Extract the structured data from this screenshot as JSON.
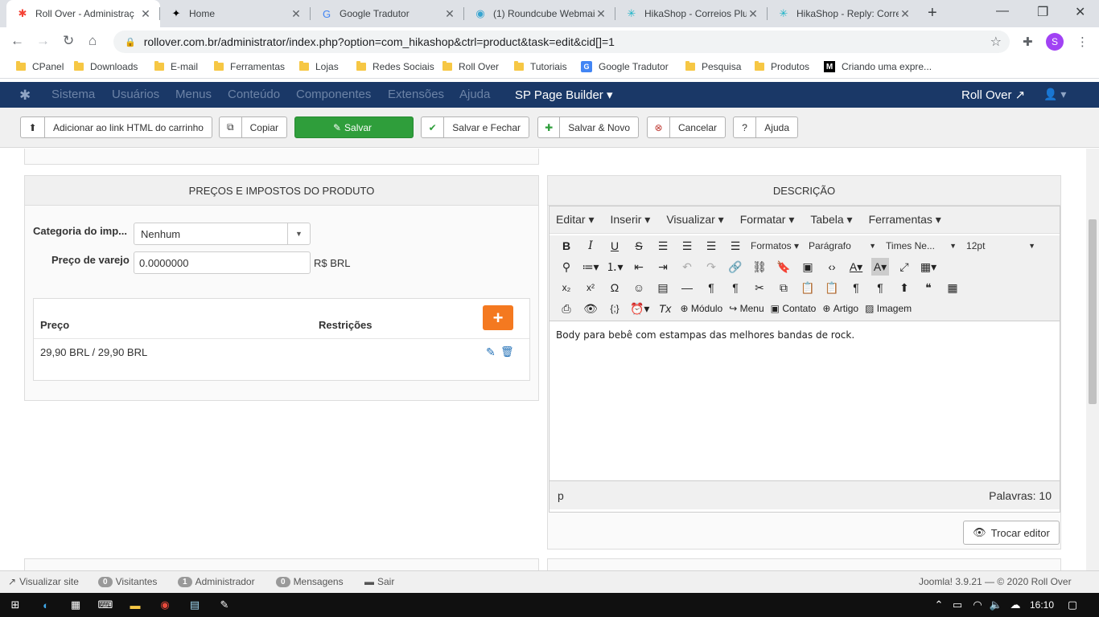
{
  "browser": {
    "tabs": [
      {
        "label": "Roll Over - Administraç",
        "icon": "joomla-icon",
        "glyph": "✱",
        "color": "#f44336"
      },
      {
        "label": "Home",
        "icon": "runner-icon",
        "glyph": "✦",
        "color": "#000000"
      },
      {
        "label": "Google Tradutor",
        "icon": "translate-icon",
        "glyph": "G",
        "color": "#4285f4"
      },
      {
        "label": "(1) Roundcube Webmai",
        "icon": "roundcube-icon",
        "glyph": "◉",
        "color": "#37a4d0"
      },
      {
        "label": "HikaShop - Correios Plu",
        "icon": "hikashop-icon",
        "glyph": "✳",
        "color": "#1bb3c7"
      },
      {
        "label": "HikaShop - Reply: Corre",
        "icon": "hikashop-icon",
        "glyph": "✳",
        "color": "#1bb3c7"
      }
    ],
    "new_tab": "+",
    "url": "rollover.com.br/administrator/index.php?option=com_hikashop&ctrl=product&task=edit&cid[]=1",
    "profile_initial": "S",
    "bookmarks": [
      {
        "label": "CPanel",
        "type": "folder"
      },
      {
        "label": "Downloads",
        "type": "folder"
      },
      {
        "label": "E-mail",
        "type": "folder"
      },
      {
        "label": "Ferramentas",
        "type": "folder"
      },
      {
        "label": "Lojas",
        "type": "folder"
      },
      {
        "label": "Redes Sociais",
        "type": "folder"
      },
      {
        "label": "Roll Over",
        "type": "folder"
      },
      {
        "label": "Tutoriais",
        "type": "folder"
      },
      {
        "label": "Google Tradutor",
        "type": "google"
      },
      {
        "label": "Pesquisa",
        "type": "folder"
      },
      {
        "label": "Produtos",
        "type": "folder"
      },
      {
        "label": "Criando uma expre...",
        "type": "medium"
      }
    ]
  },
  "joomla": {
    "nav": [
      "Sistema",
      "Usuários",
      "Menus",
      "Conteúdo",
      "Componentes",
      "Extensões",
      "Ajuda"
    ],
    "page_builder": "SP Page Builder ▾",
    "site_name": "Roll Over ↗",
    "user_menu": "▾"
  },
  "toolbar": {
    "add_link": "Adicionar ao link HTML do carrinho",
    "copy": "Copiar",
    "save": "Salvar",
    "save_close": "Salvar e Fechar",
    "save_new": "Salvar & Novo",
    "cancel": "Cancelar",
    "help": "Ajuda"
  },
  "prices_panel": {
    "title": "PREÇOS E IMPOSTOS DO PRODUTO",
    "tax_label": "Categoria do imp...",
    "tax_value": "Nenhum",
    "retail_label": "Preço de varejo",
    "retail_value": "0.0000000",
    "retail_unit": "R$ BRL",
    "col_price": "Preço",
    "col_restrictions": "Restrições",
    "add": "+",
    "rows": [
      {
        "price": "29,90 BRL / 29,90 BRL"
      }
    ]
  },
  "description_panel": {
    "title": "DESCRIÇÃO",
    "menus": [
      "Editar ▾",
      "Inserir ▾",
      "Visualizar ▾",
      "Formatar ▾",
      "Tabela ▾",
      "Ferramentas ▾"
    ],
    "formats": "Formatos ▾",
    "paragraph": "Parágrafo",
    "font": "Times Ne...",
    "size": "12pt",
    "insert_module": "Módulo",
    "insert_menu": "Menu",
    "insert_contact": "Contato",
    "insert_article": "Artigo",
    "insert_image": "Imagem",
    "body": "Body para bebê com estampas das melhores bandas de rock.",
    "path": "p",
    "word_count": "Palavras: 10",
    "toggle_editor": "Trocar editor"
  },
  "statusbar": {
    "view_site": "Visualizar site",
    "visitors_count": "0",
    "visitors": "Visitantes",
    "admins_count": "1",
    "admins": "Administrador",
    "messages_count": "0",
    "messages": "Mensagens",
    "logout": "Sair",
    "version": "Joomla! 3.9.21  —  © 2020 Roll Over"
  },
  "taskbar": {
    "time": "16:10"
  }
}
